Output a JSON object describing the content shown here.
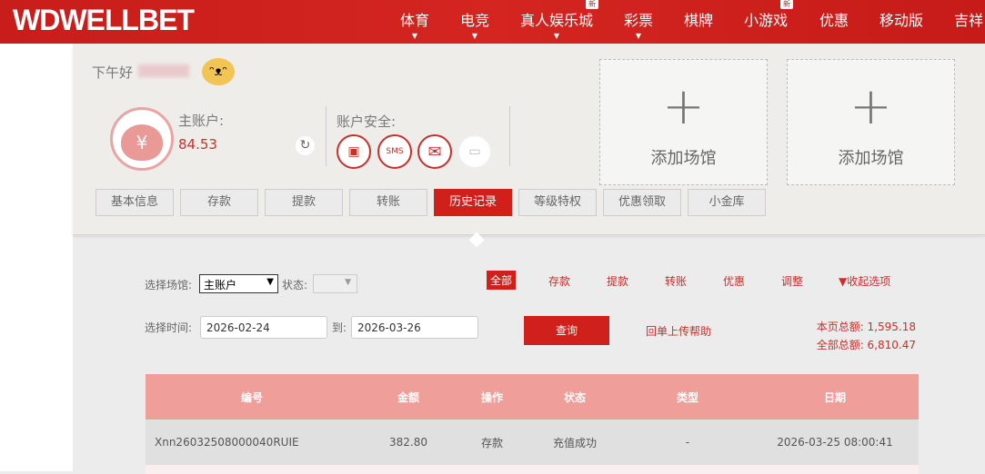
{
  "header": {
    "logo": "WDWELLBET",
    "nav": [
      {
        "label": "体育",
        "caret": true
      },
      {
        "label": "电竞",
        "caret": true
      },
      {
        "label": "真人娱乐城",
        "caret": true,
        "badge": "新"
      },
      {
        "label": "彩票",
        "caret": true
      },
      {
        "label": "棋牌"
      },
      {
        "label": "小游戏",
        "badge": "新"
      },
      {
        "label": "优惠"
      },
      {
        "label": "移动版"
      },
      {
        "label": "吉祥"
      }
    ]
  },
  "account": {
    "greeting": "下午好",
    "main_label": "主账户:",
    "balance": "84.53",
    "security_label": "账户安全:",
    "currency_symbol": "¥",
    "sms": "SMS"
  },
  "venues": [
    {
      "plus": "+",
      "label": "添加场馆"
    },
    {
      "plus": "+",
      "label": "添加场馆"
    }
  ],
  "tabs": [
    "基本信息",
    "存款",
    "提款",
    "转账",
    "历史记录",
    "等级特权",
    "优惠领取",
    "小金库"
  ],
  "active_tab": "历史记录",
  "filters": {
    "venue_label": "选择场馆:",
    "venue_value": "主账户",
    "status_label": "状态:",
    "types": [
      "全部",
      "存款",
      "提款",
      "转账",
      "优惠",
      "调整"
    ],
    "active_type": "全部",
    "collapse": "▼收起选项",
    "time_label": "选择时间:",
    "from": "2026-02-24",
    "to_label": "到:",
    "to": "2026-03-26",
    "query": "查询",
    "help": "回单上传帮助",
    "page_total": "本页总额: 1,595.18",
    "all_total": "全部总额: 6,810.47"
  },
  "table": {
    "headers": [
      "编号",
      "金额",
      "操作",
      "状态",
      "类型",
      "日期"
    ],
    "rows": [
      [
        "Xnn26032508000040RUIE",
        "382.80",
        "存款",
        "充值成功",
        "-",
        "2026-03-25 08:00:41"
      ]
    ]
  },
  "colors": {
    "brand": "#d0201c",
    "table_header": "#ef9e99"
  }
}
